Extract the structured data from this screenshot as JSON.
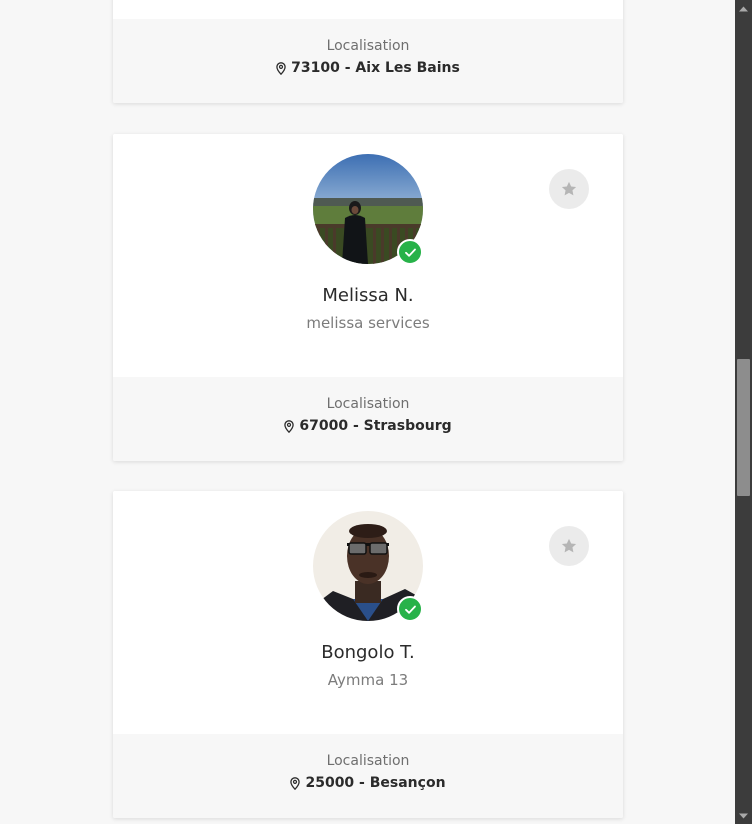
{
  "profiles": [
    {
      "name": "",
      "company": "",
      "location_label": "Localisation",
      "location": "73100 - Aix Les Bains"
    },
    {
      "name": "Melissa N.",
      "company": "melissa services",
      "location_label": "Localisation",
      "location": "67000 - Strasbourg",
      "verified": true
    },
    {
      "name": "Bongolo T.",
      "company": "Aymma 13",
      "location_label": "Localisation",
      "location": "25000 - Besançon",
      "verified": true
    }
  ],
  "icons": {
    "location": "map-pin-icon",
    "verified": "check-icon",
    "favorite": "star-icon"
  },
  "colors": {
    "verified_green": "#27b249",
    "favorite_bg": "#ebebeb",
    "star_gray": "#b5b5b5",
    "footer_bg": "#f7f7f7"
  }
}
